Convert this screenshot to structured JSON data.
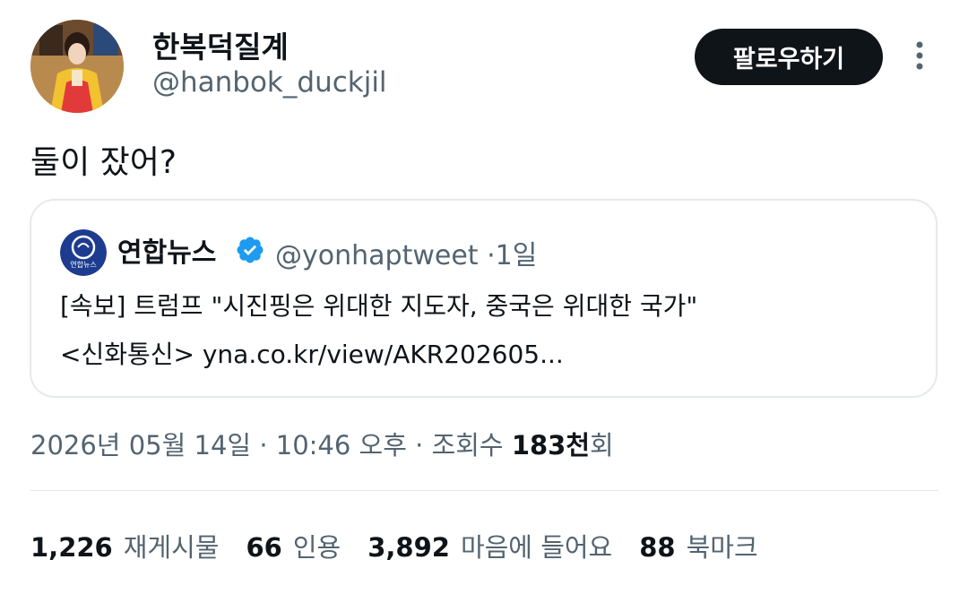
{
  "author": {
    "name": "한복덕질계",
    "handle": "@hanbok_duckjil"
  },
  "follow_button_label": "팔로우하기",
  "tweet_text": "둘이 잤어?",
  "quoted_tweet": {
    "logo_text": "연합뉴스",
    "author_name": "연합뉴스",
    "handle": "@yonhaptweet",
    "separator": "·",
    "time_ago": "1일",
    "line1": "[속보] 트럼프 \"시진핑은 위대한 지도자, 중국은 위대한 국가\"",
    "line2": "<신화통신> yna.co.kr/view/AKR202605..."
  },
  "timestamp": {
    "date": "2026년 05월 14일",
    "sep1": "·",
    "time": "10:46 오후",
    "sep2": "·",
    "views_label": "조회수",
    "views_count": "183천",
    "views_unit": "회"
  },
  "stats": {
    "retweets_count": "1,226",
    "retweets_label": "재게시물",
    "quotes_count": "66",
    "quotes_label": "인용",
    "likes_count": "3,892",
    "likes_label": "마음에 들어요",
    "bookmarks_count": "88",
    "bookmarks_label": "북마크"
  },
  "colors": {
    "text_primary": "#0f1419",
    "text_secondary": "#536471",
    "follow_bg": "#0f1419",
    "verified_blue": "#1d9bf0",
    "border": "#e6e9ec"
  },
  "icons": [
    "more-vertical-icon",
    "verified-badge-icon"
  ]
}
